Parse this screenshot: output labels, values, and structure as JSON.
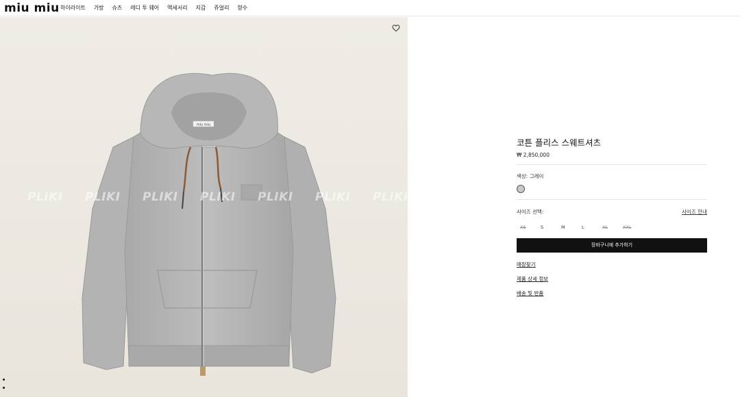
{
  "header": {
    "logo": "miu miu",
    "nav": [
      "하이라이트",
      "가방",
      "슈즈",
      "레디 투 웨어",
      "액세서리",
      "지갑",
      "쥬얼리",
      "향수"
    ]
  },
  "gallery": {
    "watermark": "PLIKI",
    "label_text": "miu miu"
  },
  "product": {
    "title": "코튼 플리스 스웨트셔츠",
    "price": "₩ 2,850,000",
    "color_label": "색상: 그레이",
    "color_hex": "#c8c8c8",
    "size_label": "사이즈 선택:",
    "size_guide": "사이즈 안내",
    "sizes": [
      {
        "label": "XS",
        "available": false
      },
      {
        "label": "S",
        "available": true
      },
      {
        "label": "M",
        "available": true
      },
      {
        "label": "L",
        "available": true
      },
      {
        "label": "XL",
        "available": false
      },
      {
        "label": "XXL",
        "available": false
      }
    ],
    "add_to_cart": "장바구니에 추가하기",
    "links": [
      "매장찾기",
      "제품 상세 정보",
      "배송 및 반품"
    ]
  },
  "colors": {
    "accent": "#111111",
    "image_bg": "#ece9e2"
  }
}
